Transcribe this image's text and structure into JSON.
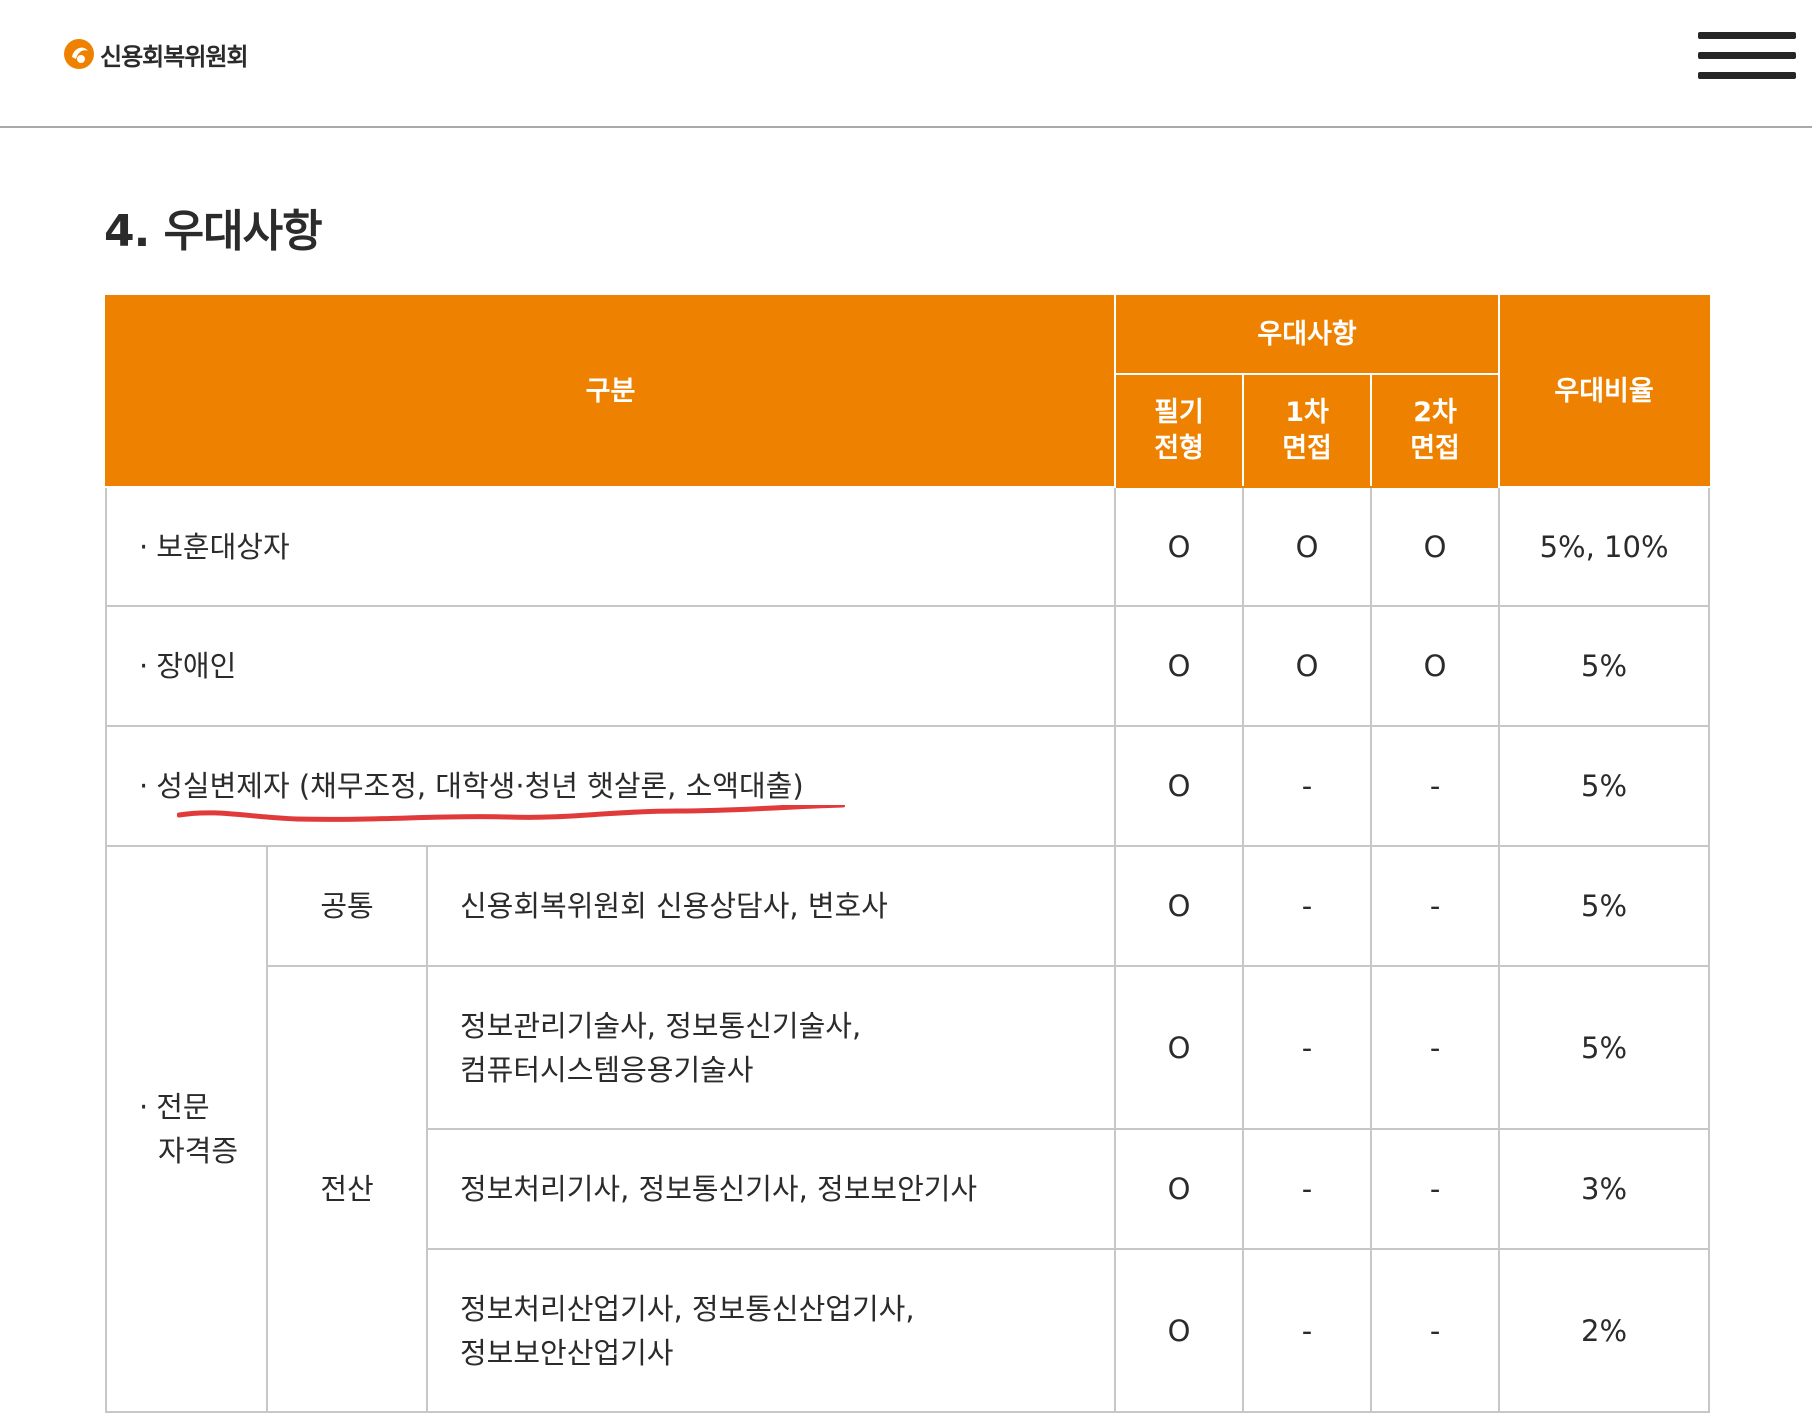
{
  "header": {
    "logo_text": "신용회복위원회",
    "menu_icon": "hamburger-menu-icon",
    "brand_color": "#ee8200"
  },
  "section": {
    "title": "4. 우대사항"
  },
  "table": {
    "headers": {
      "category": "구분",
      "benefit_group": "우대사항",
      "written": "필기 전형",
      "written_lines": [
        "필기",
        "전형"
      ],
      "interview1_lines": [
        "1차",
        "면접"
      ],
      "interview2_lines": [
        "2차",
        "면접"
      ],
      "rate": "우대비율"
    },
    "rows": [
      {
        "category": "보훈대상자",
        "written": "O",
        "interview1": "O",
        "interview2": "O",
        "rate": "5%, 10%"
      },
      {
        "category": "장애인",
        "written": "O",
        "interview1": "O",
        "interview2": "O",
        "rate": "5%"
      },
      {
        "category": "성실변제자 (채무조정, 대학생·청년 햇살론, 소액대출)",
        "written": "O",
        "interview1": "-",
        "interview2": "-",
        "rate": "5%",
        "annotated": true
      }
    ],
    "certificate": {
      "category_lines": [
        "전문",
        "자격증"
      ],
      "groups": [
        {
          "name": "공통",
          "items": [
            {
              "lines": [
                "신용회복위원회 신용상담사, 변호사"
              ],
              "written": "O",
              "interview1": "-",
              "interview2": "-",
              "rate": "5%"
            }
          ]
        },
        {
          "name": "전산",
          "items": [
            {
              "lines": [
                "정보관리기술사, 정보통신기술사,",
                "컴퓨터시스템응용기술사"
              ],
              "written": "O",
              "interview1": "-",
              "interview2": "-",
              "rate": "5%"
            },
            {
              "lines": [
                "정보처리기사, 정보통신기사, 정보보안기사"
              ],
              "written": "O",
              "interview1": "-",
              "interview2": "-",
              "rate": "3%"
            },
            {
              "lines": [
                "정보처리산업기사, 정보통신산업기사,",
                "정보보안산업기사"
              ],
              "written": "O",
              "interview1": "-",
              "interview2": "-",
              "rate": "2%"
            }
          ]
        }
      ]
    },
    "bullet": "·",
    "annotation_color": "#e03a3a"
  }
}
